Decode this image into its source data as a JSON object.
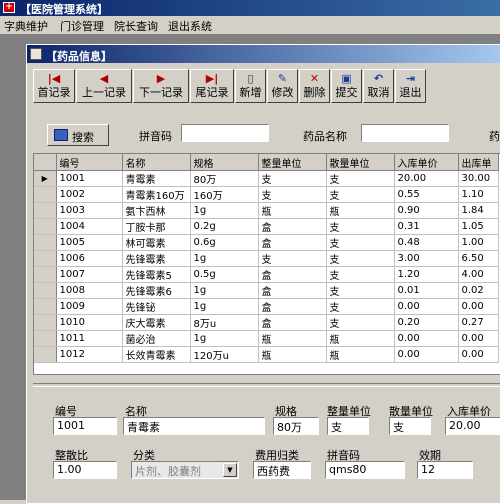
{
  "app": {
    "title": "【医院管理系统】"
  },
  "menu": [
    "字典维护",
    "门诊管理",
    "院长查询",
    "退出系统"
  ],
  "window": {
    "title": "【药品信息】"
  },
  "toolbar": [
    {
      "label": "首记录",
      "icon": "first-record-icon",
      "glyph": "|◀"
    },
    {
      "label": "上一记录",
      "icon": "prev-record-icon",
      "glyph": "◀"
    },
    {
      "label": "下一记录",
      "icon": "next-record-icon",
      "glyph": "▶"
    },
    {
      "label": "尾记录",
      "icon": "last-record-icon",
      "glyph": "▶|"
    },
    {
      "label": "新增",
      "icon": "new-icon",
      "glyph": "▯"
    },
    {
      "label": "修改",
      "icon": "edit-icon",
      "glyph": "✎"
    },
    {
      "label": "删除",
      "icon": "delete-icon",
      "glyph": "✕"
    },
    {
      "label": "提交",
      "icon": "save-icon",
      "glyph": "▣"
    },
    {
      "label": "取消",
      "icon": "undo-icon",
      "glyph": "↶"
    },
    {
      "label": "退出",
      "icon": "exit-icon",
      "glyph": "⇥"
    }
  ],
  "search": {
    "button_label": "搜索",
    "pinyin_label": "拼音码",
    "pinyin_value": "",
    "drugname_label": "药品名称",
    "drugname_value": "",
    "cut_label": "药"
  },
  "grid": {
    "columns": [
      "编号",
      "名称",
      "规格",
      "整量单位",
      "散量单位",
      "入库单价",
      "出库单"
    ],
    "current_row_marker": "▶",
    "rows": [
      [
        "1001",
        "青霉素",
        "80万",
        "支",
        "支",
        "20.00",
        "30.00"
      ],
      [
        "1002",
        "青霉素160万",
        "160万",
        "支",
        "支",
        "0.55",
        "1.10"
      ],
      [
        "1003",
        "氨卞西林",
        "1g",
        "瓶",
        "瓶",
        "0.90",
        "1.84"
      ],
      [
        "1004",
        "丁胺卡那",
        "0.2g",
        "盒",
        "支",
        "0.31",
        "1.05"
      ],
      [
        "1005",
        "林可霉素",
        "0.6g",
        "盒",
        "支",
        "0.48",
        "1.00"
      ],
      [
        "1006",
        "先锋霉素",
        "1g",
        "支",
        "支",
        "3.00",
        "6.50"
      ],
      [
        "1007",
        "先锋霉素5",
        "0.5g",
        "盒",
        "支",
        "1.20",
        "4.00"
      ],
      [
        "1008",
        "先锋霉素6",
        "1g",
        "盒",
        "支",
        "0.01",
        "0.02"
      ],
      [
        "1009",
        "先锋铋",
        "1g",
        "盒",
        "支",
        "0.00",
        "0.00"
      ],
      [
        "1010",
        "庆大霉素",
        "8万u",
        "盒",
        "支",
        "0.20",
        "0.27"
      ],
      [
        "1011",
        "菌必治",
        "1g",
        "瓶",
        "瓶",
        "0.00",
        "0.00"
      ],
      [
        "1012",
        "长效青霉素",
        "120万u",
        "瓶",
        "瓶",
        "0.00",
        "0.00"
      ]
    ]
  },
  "detail": {
    "code_label": "编号",
    "code_value": "1001",
    "name_label": "名称",
    "name_value": "青霉素",
    "spec_label": "规格",
    "spec_value": "80万",
    "unit_label": "整量单位",
    "unit_value": "支",
    "subunit_label": "散量单位",
    "subunit_value": "支",
    "inprice_label": "入库单价",
    "inprice_value": "20.00",
    "ratio_label": "整散比",
    "ratio_value": "1.00",
    "category_label": "分类",
    "category_value": "片剂、胶囊剂",
    "feetype_label": "费用归类",
    "feetype_value": "西药费",
    "pinyin_label": "拼音码",
    "pinyin_value": "qms80",
    "validity_label": "效期",
    "validity_value": "12"
  },
  "colors": {
    "title_start": "#0a246a",
    "title_end": "#a6caf0",
    "face": "#d4d0c8"
  }
}
